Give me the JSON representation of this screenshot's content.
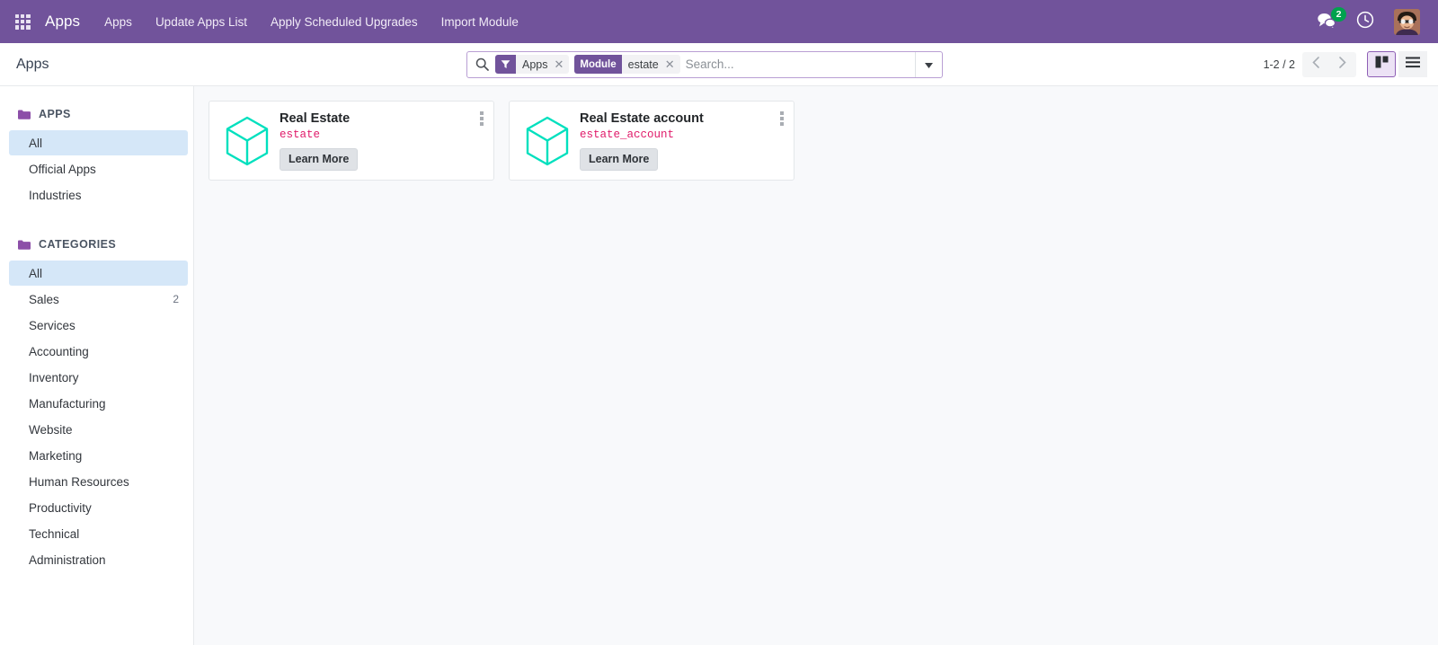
{
  "navbar": {
    "apps_grid_icon": "apps-grid-icon",
    "brand": "Apps",
    "menu_items": [
      {
        "label": "Apps"
      },
      {
        "label": "Update Apps List"
      },
      {
        "label": "Apply Scheduled Upgrades"
      },
      {
        "label": "Import Module"
      }
    ],
    "systray": {
      "messaging_icon": "messages-icon",
      "messaging_count": "2",
      "activity_icon": "clock-icon",
      "avatar_icon": "user-avatar"
    },
    "bg_color": "#71539B",
    "badge_color": "#00A24E"
  },
  "control_panel": {
    "breadcrumb": "Apps",
    "search": {
      "search_icon": "search-icon",
      "placeholder": "Search...",
      "value": "",
      "dropdown_icon": "caret-down-icon",
      "facets": [
        {
          "icon": "filter-funnel-icon",
          "label": "",
          "value": "Apps",
          "remove_icon": "close-icon"
        },
        {
          "icon": "",
          "label": "Module",
          "value": "estate",
          "remove_icon": "close-icon"
        }
      ]
    },
    "pager": {
      "range": "1-2 / 2",
      "prev_icon": "chevron-left-icon",
      "next_icon": "chevron-right-icon"
    },
    "view_switcher": [
      {
        "name": "kanban",
        "icon": "kanban-view-icon",
        "active": true
      },
      {
        "name": "list",
        "icon": "list-view-icon",
        "active": false
      }
    ]
  },
  "sidebar": {
    "sections": [
      {
        "title": "APPS",
        "folder_icon": "folder-icon",
        "items": [
          {
            "label": "All",
            "count": "",
            "active": true
          },
          {
            "label": "Official Apps",
            "count": "",
            "active": false
          },
          {
            "label": "Industries",
            "count": "",
            "active": false
          }
        ]
      },
      {
        "title": "CATEGORIES",
        "folder_icon": "folder-icon",
        "items": [
          {
            "label": "All",
            "count": "",
            "active": true
          },
          {
            "label": "Sales",
            "count": "2",
            "active": false
          },
          {
            "label": "Services",
            "count": "",
            "active": false
          },
          {
            "label": "Accounting",
            "count": "",
            "active": false
          },
          {
            "label": "Inventory",
            "count": "",
            "active": false
          },
          {
            "label": "Manufacturing",
            "count": "",
            "active": false
          },
          {
            "label": "Website",
            "count": "",
            "active": false
          },
          {
            "label": "Marketing",
            "count": "",
            "active": false
          },
          {
            "label": "Human Resources",
            "count": "",
            "active": false
          },
          {
            "label": "Productivity",
            "count": "",
            "active": false
          },
          {
            "label": "Technical",
            "count": "",
            "active": false
          },
          {
            "label": "Administration",
            "count": "",
            "active": false
          }
        ]
      }
    ]
  },
  "kanban": {
    "accent_icon_color": "#00E0BE",
    "tech_name_color": "#E01B6A",
    "cards": [
      {
        "icon": "cube-module-icon",
        "title": "Real Estate",
        "technical_name": "estate",
        "button_label": "Learn More",
        "menu_icon": "vertical-ellipsis-icon"
      },
      {
        "icon": "cube-module-icon",
        "title": "Real Estate account",
        "technical_name": "estate_account",
        "button_label": "Learn More",
        "menu_icon": "vertical-ellipsis-icon"
      }
    ]
  }
}
